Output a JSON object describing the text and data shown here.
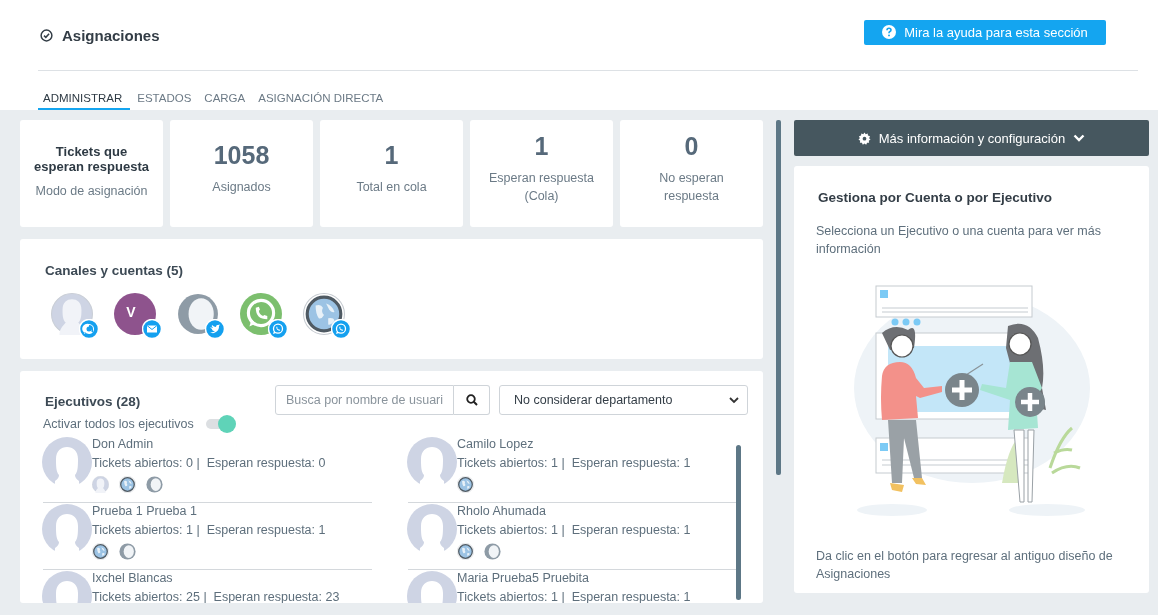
{
  "header": {
    "title": "Asignaciones",
    "help_button": "Mira la ayuda para esta sección"
  },
  "tabs": [
    {
      "label": "ADMINISTRAR",
      "selected": true
    },
    {
      "label": "ESTADOS",
      "selected": false
    },
    {
      "label": "CARGA",
      "selected": false
    },
    {
      "label": "ASIGNACIÓN DIRECTA",
      "selected": false
    }
  ],
  "stats": [
    {
      "kind": "mode",
      "value": "Tickets que esperan respuesta",
      "label": "Modo de asignación"
    },
    {
      "kind": "count",
      "value": "1058",
      "label": "Asignados"
    },
    {
      "kind": "count",
      "value": "1",
      "label": "Total en cola"
    },
    {
      "kind": "count",
      "value": "1",
      "label": "Esperan respuesta (Cola)"
    },
    {
      "kind": "count",
      "value": "0",
      "label": "No esperan respuesta"
    }
  ],
  "channels": {
    "title": "Canales y cuentas (5)",
    "accounts": [
      {
        "kind": "silhouette",
        "badge": {
          "kind": "chat"
        }
      },
      {
        "kind": "letter",
        "letter": "V",
        "badge": {
          "kind": "mail"
        }
      },
      {
        "kind": "ring",
        "badge": {
          "kind": "twitter"
        }
      },
      {
        "kind": "whatsapp",
        "badge": {
          "kind": "whatsapp"
        }
      },
      {
        "kind": "globe",
        "badge": {
          "kind": "whatsapp"
        }
      }
    ]
  },
  "executives": {
    "title": "Ejecutivos (28)",
    "search": {
      "placeholder": "Busca por nombre de usuari"
    },
    "department": "No considerar departamento",
    "toggle": {
      "label": "Activar todos los ejecutivos",
      "on": true
    },
    "columns": [
      [
        {
          "name": "Don Admin",
          "stats": "Tickets abiertos: 0 |  Esperan respuesta: 0",
          "channels": [
            {
              "kind": "silhouette"
            },
            {
              "kind": "globe"
            },
            {
              "kind": "ring"
            }
          ]
        },
        {
          "name": "Prueba 1 Prueba 1",
          "stats": "Tickets abiertos: 1 |  Esperan respuesta: 1",
          "channels": [
            {
              "kind": "globe"
            },
            {
              "kind": "ring"
            }
          ]
        },
        {
          "name": "Ixchel Blancas",
          "stats": "Tickets abiertos: 25 |  Esperan respuesta: 23"
        }
      ],
      [
        {
          "name": "Camilo Lopez",
          "stats": "Tickets abiertos: 1 |  Esperan respuesta: 1",
          "channels": [
            {
              "kind": "globe"
            }
          ]
        },
        {
          "name": "Rholo Ahumada",
          "stats": "Tickets abiertos: 1 |  Esperan respuesta: 1",
          "channels": [
            {
              "kind": "globe"
            },
            {
              "kind": "ring"
            }
          ]
        },
        {
          "name": "Maria Prueba5 Pruebita",
          "stats": "Tickets abiertos: 1 |  Esperan respuesta: 1"
        }
      ]
    ]
  },
  "side": {
    "config_button": "Más información y configuración",
    "title": "Gestiona por Cuenta o por Ejecutivo",
    "text": "Selecciona un Ejecutivo o una cuenta para ver más información",
    "footer": "Da clic en el botón para regresar al antiguo diseño de Asignaciones"
  }
}
